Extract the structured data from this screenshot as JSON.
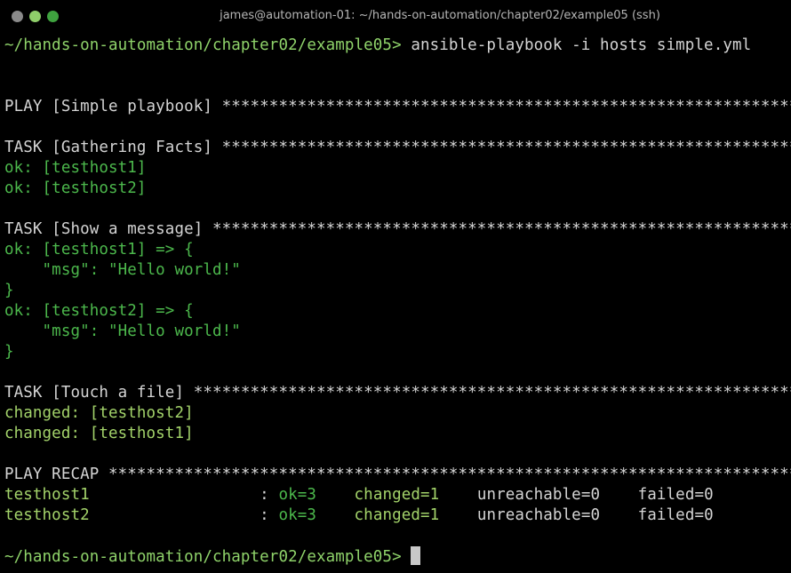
{
  "window": {
    "title": "james@automation-01: ~/hands-on-automation/chapter02/example05 (ssh)",
    "buttons": [
      "close",
      "minimize",
      "zoom"
    ]
  },
  "colors": {
    "text": "#d4d4d4",
    "prompt": "#8fd36a",
    "ok": "#4cb84c",
    "changed": "#a3d36a",
    "background": "#000000"
  },
  "terminal": {
    "lines": [
      [
        {
          "t": "~/hands-on-automation/chapter02/example05> ",
          "c": "prompt"
        },
        {
          "t": "ansible-playbook -i hosts simple.yml",
          "c": "text"
        }
      ],
      [],
      [],
      [
        {
          "t": "PLAY [Simple playbook] *****************************************************************",
          "c": "text"
        }
      ],
      [],
      [
        {
          "t": "TASK [Gathering Facts] *****************************************************************",
          "c": "text"
        }
      ],
      [
        {
          "t": "ok: [testhost1]",
          "c": "ok"
        }
      ],
      [
        {
          "t": "ok: [testhost2]",
          "c": "ok"
        }
      ],
      [],
      [
        {
          "t": "TASK [Show a message] ******************************************************************",
          "c": "text"
        }
      ],
      [
        {
          "t": "ok: [testhost1] => {",
          "c": "ok"
        }
      ],
      [
        {
          "t": "    \"msg\": \"Hello world!\"",
          "c": "ok"
        }
      ],
      [
        {
          "t": "}",
          "c": "ok"
        }
      ],
      [
        {
          "t": "ok: [testhost2] => {",
          "c": "ok"
        }
      ],
      [
        {
          "t": "    \"msg\": \"Hello world!\"",
          "c": "ok"
        }
      ],
      [
        {
          "t": "}",
          "c": "ok"
        }
      ],
      [],
      [
        {
          "t": "TASK [Touch a file] ********************************************************************",
          "c": "text"
        }
      ],
      [
        {
          "t": "changed: [testhost2]",
          "c": "changed"
        }
      ],
      [
        {
          "t": "changed: [testhost1]",
          "c": "changed"
        }
      ],
      [],
      [
        {
          "t": "PLAY RECAP *****************************************************************************",
          "c": "text"
        }
      ],
      [
        {
          "t": "testhost1",
          "c": "changed"
        },
        {
          "t": "                  : ",
          "c": "text"
        },
        {
          "t": "ok=3",
          "c": "ok"
        },
        {
          "t": "    ",
          "c": "text"
        },
        {
          "t": "changed=1",
          "c": "changed"
        },
        {
          "t": "    unreachable=0    failed=0",
          "c": "text"
        }
      ],
      [
        {
          "t": "testhost2",
          "c": "changed"
        },
        {
          "t": "                  : ",
          "c": "text"
        },
        {
          "t": "ok=3",
          "c": "ok"
        },
        {
          "t": "    ",
          "c": "text"
        },
        {
          "t": "changed=1",
          "c": "changed"
        },
        {
          "t": "    unreachable=0    failed=0",
          "c": "text"
        }
      ],
      [],
      [
        {
          "t": "~/hands-on-automation/chapter02/example05> ",
          "c": "prompt"
        }
      ]
    ]
  }
}
